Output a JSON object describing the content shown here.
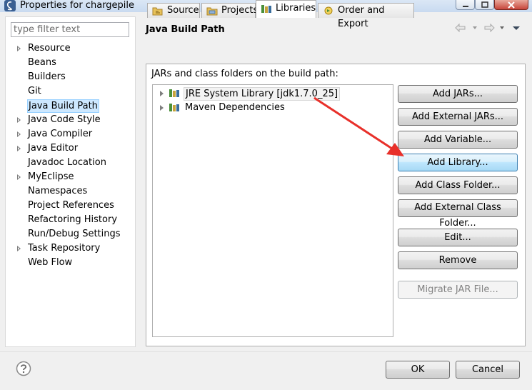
{
  "window": {
    "title": "Properties for chargepile"
  },
  "filter": {
    "placeholder": "type filter text"
  },
  "tree": [
    {
      "label": "Resource",
      "expandable": true,
      "selected": false
    },
    {
      "label": "Beans",
      "expandable": false,
      "selected": false
    },
    {
      "label": "Builders",
      "expandable": false,
      "selected": false
    },
    {
      "label": "Git",
      "expandable": false,
      "selected": false
    },
    {
      "label": "Java Build Path",
      "expandable": false,
      "selected": true
    },
    {
      "label": "Java Code Style",
      "expandable": true,
      "selected": false
    },
    {
      "label": "Java Compiler",
      "expandable": true,
      "selected": false
    },
    {
      "label": "Java Editor",
      "expandable": true,
      "selected": false
    },
    {
      "label": "Javadoc Location",
      "expandable": false,
      "selected": false
    },
    {
      "label": "MyEclipse",
      "expandable": true,
      "selected": false
    },
    {
      "label": "Namespaces",
      "expandable": false,
      "selected": false
    },
    {
      "label": "Project References",
      "expandable": false,
      "selected": false
    },
    {
      "label": "Refactoring History",
      "expandable": false,
      "selected": false
    },
    {
      "label": "Run/Debug Settings",
      "expandable": false,
      "selected": false
    },
    {
      "label": "Task Repository",
      "expandable": true,
      "selected": false
    },
    {
      "label": "Web Flow",
      "expandable": false,
      "selected": false
    }
  ],
  "page": {
    "title": "Java Build Path"
  },
  "tabs": [
    {
      "label": "Source",
      "icon": "source-folder-icon"
    },
    {
      "label": "Projects",
      "icon": "projects-icon"
    },
    {
      "label": "Libraries",
      "icon": "libraries-icon",
      "active": true
    },
    {
      "label": "Order and Export",
      "icon": "order-export-icon"
    }
  ],
  "libraries": {
    "heading": "JARs and class folders on the build path:",
    "items": [
      {
        "label": "JRE System Library [jdk1.7.0_25]",
        "selected": true
      },
      {
        "label": "Maven Dependencies",
        "selected": false
      }
    ]
  },
  "buttons": {
    "add_jars": "Add JARs...",
    "add_external_jars": "Add External JARs...",
    "add_variable": "Add Variable...",
    "add_library": "Add Library...",
    "add_class_folder": "Add Class Folder...",
    "add_external_class_folder": "Add External Class Folder...",
    "edit": "Edit...",
    "remove": "Remove",
    "migrate_jar": "Migrate JAR File..."
  },
  "dialog": {
    "ok": "OK",
    "cancel": "Cancel"
  },
  "colors": {
    "annotation_arrow": "#e8302a",
    "selection": "#cde8ff",
    "hover_button": "#bee6fd"
  }
}
